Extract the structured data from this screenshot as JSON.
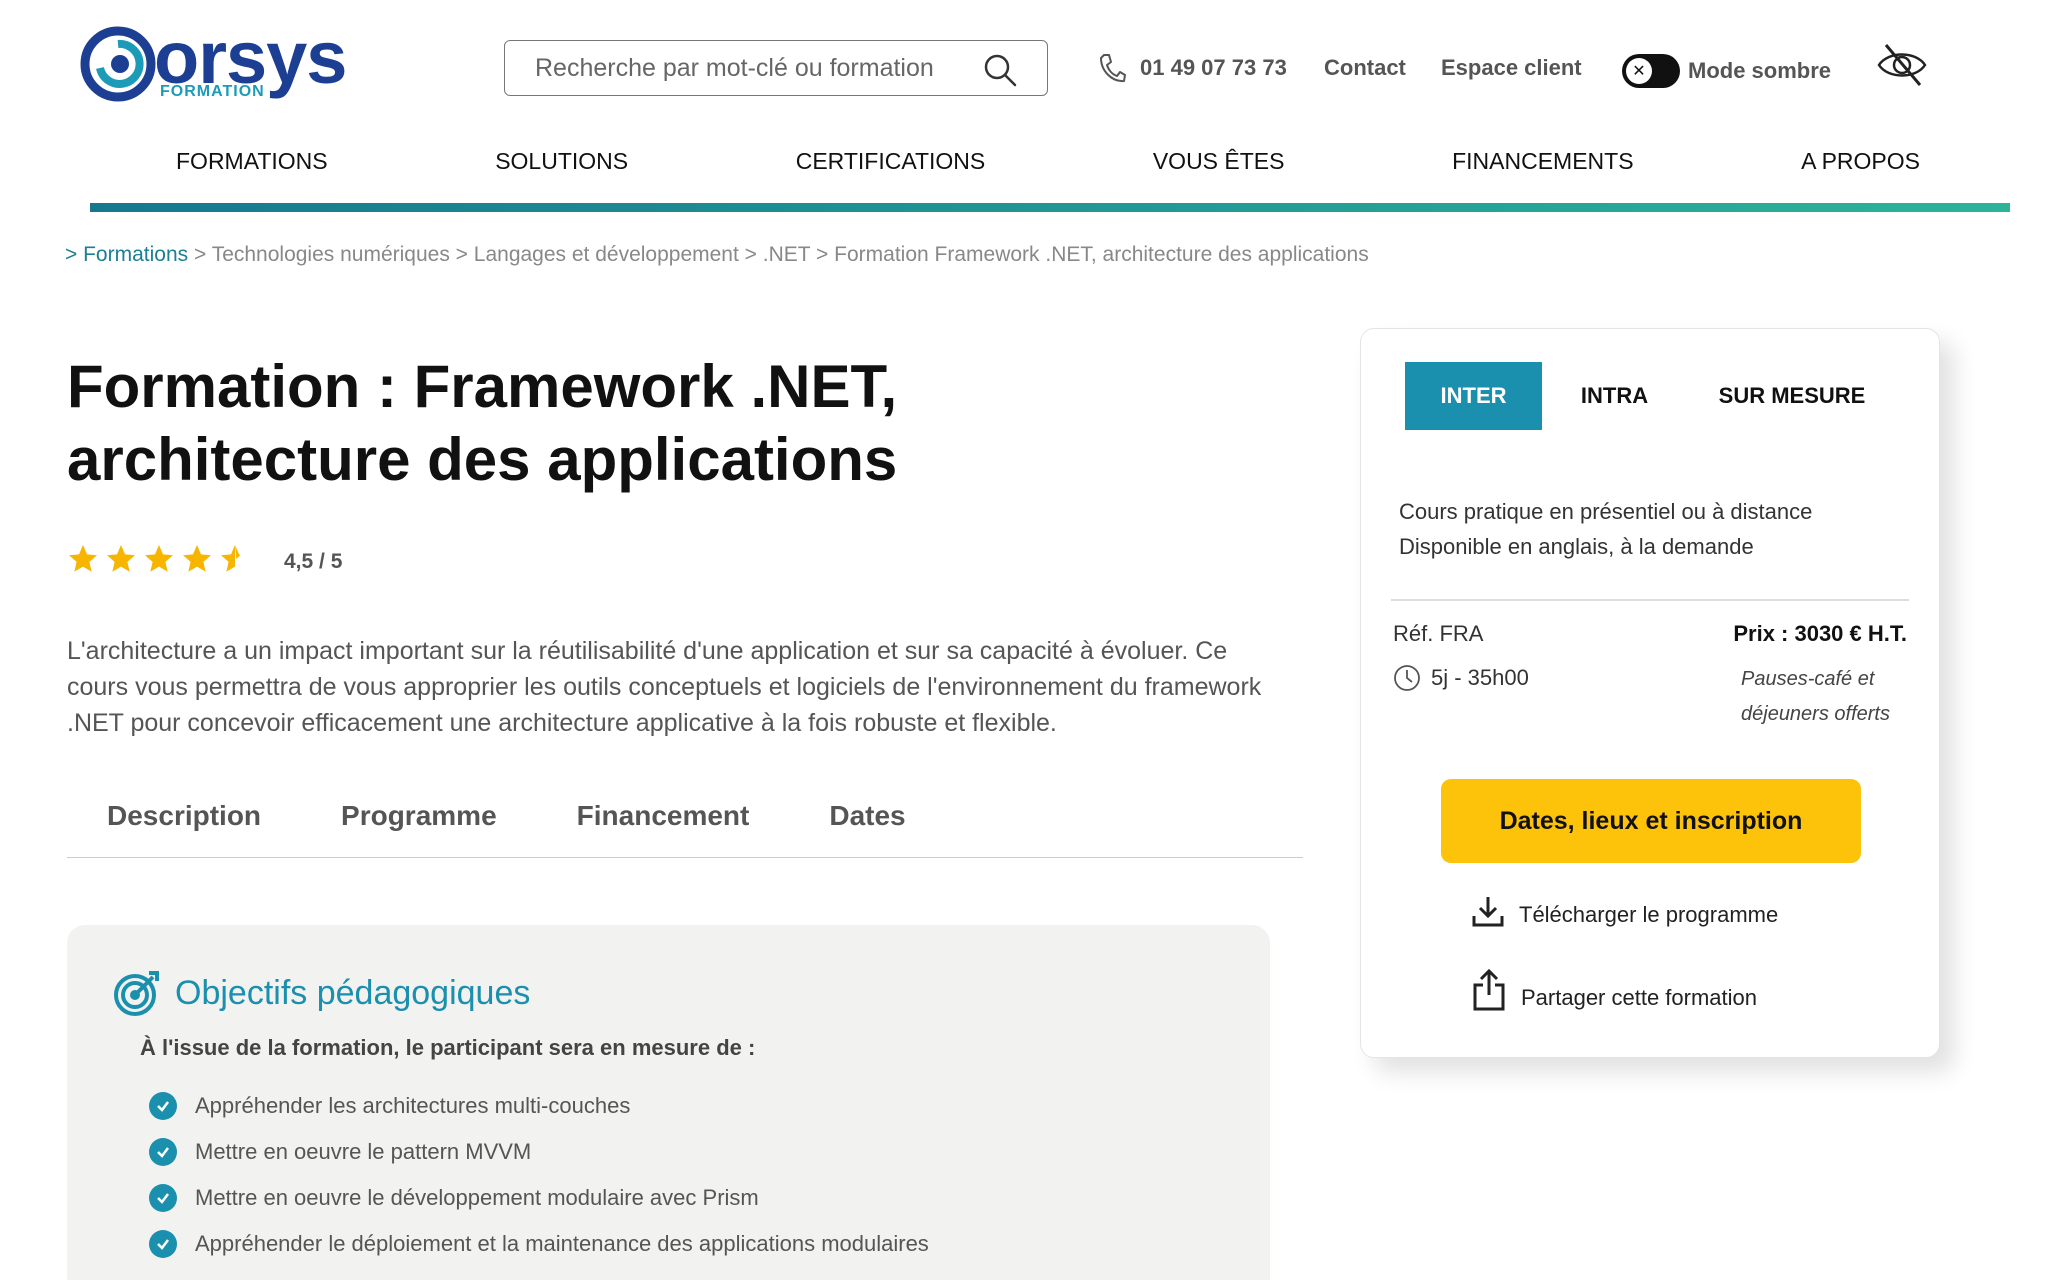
{
  "header": {
    "logo_word": "orsys",
    "logo_sub": "FORMATION",
    "search_placeholder": "Recherche par mot-clé ou formation",
    "phone": "01 49 07 73 73",
    "contact": "Contact",
    "espace_client": "Espace client",
    "dark_mode": "Mode sombre"
  },
  "nav": {
    "items": [
      {
        "label": "FORMATIONS"
      },
      {
        "label": "SOLUTIONS"
      },
      {
        "label": "CERTIFICATIONS"
      },
      {
        "label": "VOUS ÊTES"
      },
      {
        "label": "FINANCEMENTS"
      },
      {
        "label": "A PROPOS"
      }
    ]
  },
  "breadcrumb": {
    "items": [
      "> Formations",
      " > Technologies numériques",
      " > Langages et développement",
      " > .NET",
      " > Formation Framework .NET, architecture des applications"
    ]
  },
  "page": {
    "title": "Formation : Framework .NET, architecture des applications",
    "rating_value": 4.5,
    "rating_text": "4,5 / 5",
    "intro": "L'architecture a un impact important sur la réutilisabilité d'une application et sur sa capacité à évoluer. Ce cours vous permettra de vous approprier les outils conceptuels et logiciels de l'environnement du framework .NET pour concevoir efficacement une architecture applicative à la fois robuste et flexible."
  },
  "tabs": [
    {
      "label": "Description"
    },
    {
      "label": "Programme"
    },
    {
      "label": "Financement"
    },
    {
      "label": "Dates"
    }
  ],
  "objectives": {
    "title": "Objectifs pédagogiques",
    "subtitle": "À l'issue de la formation, le participant sera en mesure de :",
    "items": [
      "Appréhender les architectures multi-couches",
      "Mettre en oeuvre le pattern MVVM",
      "Mettre en oeuvre le développement modulaire avec Prism",
      "Appréhender le déploiement et la maintenance des applications modulaires"
    ]
  },
  "card": {
    "tabs": [
      "INTER",
      "INTRA",
      "SUR MESURE"
    ],
    "desc_line1": "Cours pratique en présentiel ou à distance",
    "desc_line2": "Disponible en anglais, à la demande",
    "ref": "Réf. FRA",
    "duration": "5j - 35h00",
    "price": "Prix : 3030 € H.T.",
    "price_note": "Pauses-café et déjeuners offerts",
    "cta": "Dates, lieux et inscription",
    "download": "Télécharger le programme",
    "share": "Partager cette formation"
  },
  "colors": {
    "brand_blue": "#1d3f93",
    "teal": "#1b8fae",
    "cta_yellow": "#fcc30a",
    "star": "#f7b500"
  }
}
